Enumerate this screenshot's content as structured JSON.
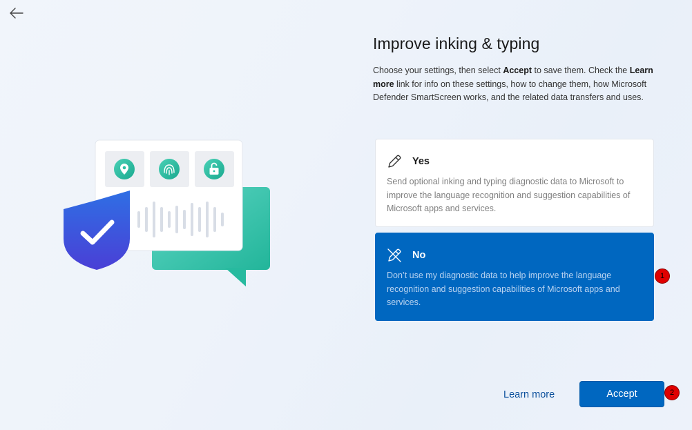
{
  "nav": {
    "back_icon": "back-arrow-icon"
  },
  "page": {
    "title": "Improve inking & typing",
    "description": {
      "part1": "Choose your settings, then select ",
      "accept_bold": "Accept",
      "part2": " to save them. Check the ",
      "learn_more_bold": "Learn more",
      "part3": " link for info on these settings, how to change them, how Microsoft Defender SmartScreen works, and the related data transfers and uses."
    }
  },
  "options": {
    "yes": {
      "title": "Yes",
      "icon": "pen-icon",
      "text": "Send optional inking and typing diagnostic data to Microsoft to improve the language recognition and suggestion capabilities of Microsoft apps and services.",
      "selected": false
    },
    "no": {
      "title": "No",
      "icon": "pen-crossed-icon",
      "text": "Don’t use my diagnostic data to help improve the language recognition and suggestion capabilities of Microsoft apps and services.",
      "selected": true
    }
  },
  "actions": {
    "learn_more": "Learn more",
    "accept": "Accept"
  },
  "markers": {
    "one": "1",
    "two": "2"
  },
  "colors": {
    "accent": "#0067c0",
    "shield": "#3b5bdb",
    "teal": "#2fc4a8"
  }
}
